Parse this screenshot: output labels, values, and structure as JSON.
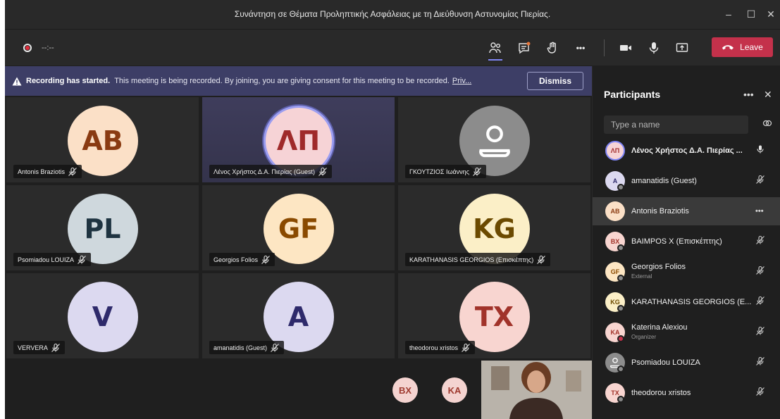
{
  "window": {
    "title": "Συνάντηση σε Θέματα Προληπτικής Ασφάλειας με τη Διεύθυνση Αστυνομίας Πιερίας.",
    "minimize": "–",
    "maximize": "☐",
    "close": "✕"
  },
  "toolbar": {
    "timer": "--:--",
    "leave_label": "Leave",
    "more": "•••"
  },
  "banner": {
    "bold_text": "Recording has started.",
    "text": "This meeting is being recorded. By joining, you are giving consent for this meeting to be recorded.",
    "link": "Priv...",
    "dismiss_label": "Dismiss"
  },
  "tiles": [
    {
      "initials": "AB",
      "name": "Antonis Braziotis",
      "bg": "#fbe0c7",
      "fg": "#8a3b12",
      "photo": false,
      "speaker": false
    },
    {
      "initials": "ΛΠ",
      "name": "Λένος Χρήστος Δ.Α. Πιερίας (Guest)",
      "bg": "#f6d3d6",
      "fg": "#9f2a2a",
      "photo": false,
      "speaker": true
    },
    {
      "initials": "",
      "name": "ΓΚΟΥΤΖΙΟΣ Ιωάννης",
      "bg": "#8c8c8c",
      "fg": "#ffffff",
      "photo": true,
      "speaker": false
    },
    {
      "initials": "PL",
      "name": "Psomiadou LOUIZA",
      "bg": "#cfd8dd",
      "fg": "#1e3340",
      "photo": false,
      "speaker": false
    },
    {
      "initials": "GF",
      "name": "Georgios Folios",
      "bg": "#fde6c3",
      "fg": "#8a4a00",
      "photo": false,
      "speaker": false
    },
    {
      "initials": "KG",
      "name": "KARATHANASIS GEORGIOS (Επισκέπτης)",
      "bg": "#fbefc7",
      "fg": "#6b4a00",
      "photo": false,
      "speaker": false
    },
    {
      "initials": "V",
      "name": "VERVERA",
      "bg": "#dcd9f0",
      "fg": "#2e2a6b",
      "photo": false,
      "speaker": false
    },
    {
      "initials": "A",
      "name": "amanatidis (Guest)",
      "bg": "#dcd9f0",
      "fg": "#2e2a6b",
      "photo": false,
      "speaker": false
    },
    {
      "initials": "TX",
      "name": "theodorou xristos",
      "bg": "#f8d5d0",
      "fg": "#a1332a",
      "photo": false,
      "speaker": false
    }
  ],
  "overflow_avatars": [
    {
      "initials": "BX"
    },
    {
      "initials": "KA"
    }
  ],
  "panel": {
    "title": "Participants",
    "more": "•••",
    "close": "✕",
    "search_placeholder": "Type a name",
    "participants": [
      {
        "initials": "ΛΠ",
        "name": "Λένος Χρήστος Δ.Α. Πιερίας ...",
        "sub": "",
        "bg": "#f6d3d6",
        "fg": "#9f2a2a",
        "icon": "mic",
        "status": "none",
        "speaking": true,
        "selected": false
      },
      {
        "initials": "A",
        "name": "amanatidis (Guest)",
        "sub": "",
        "bg": "#dcd9f0",
        "fg": "#2e2a6b",
        "icon": "mic-off",
        "status": "grey",
        "speaking": false,
        "selected": false
      },
      {
        "initials": "AB",
        "name": "Antonis Braziotis",
        "sub": "",
        "bg": "#fbe0c7",
        "fg": "#8a3b12",
        "icon": "more",
        "status": "none",
        "speaking": false,
        "selected": true
      },
      {
        "initials": "BX",
        "name": "BAIMPOS X (Επισκέπτης)",
        "sub": "",
        "bg": "#f8d5d0",
        "fg": "#a1332a",
        "icon": "mic-off",
        "status": "grey",
        "speaking": false,
        "selected": false
      },
      {
        "initials": "GF",
        "name": "Georgios Folios",
        "sub": "External",
        "bg": "#fde6c3",
        "fg": "#8a4a00",
        "icon": "mic-off",
        "status": "grey",
        "speaking": false,
        "selected": false
      },
      {
        "initials": "KG",
        "name": "KARATHANASIS GEORGIOS (E...",
        "sub": "",
        "bg": "#fbefc7",
        "fg": "#6b4a00",
        "icon": "mic-off",
        "status": "grey",
        "speaking": false,
        "selected": false
      },
      {
        "initials": "KA",
        "name": "Katerina Alexiou",
        "sub": "Organizer",
        "bg": "#f8d5d0",
        "fg": "#a1332a",
        "icon": "mic-off",
        "status": "red",
        "speaking": false,
        "selected": false
      },
      {
        "initials": "",
        "name": "Psomiadou LOUIZA",
        "sub": "",
        "bg": "#8c8c8c",
        "fg": "#ffffff",
        "icon": "mic-off",
        "status": "grey",
        "speaking": false,
        "selected": false
      },
      {
        "initials": "TX",
        "name": "theodorou xristos",
        "sub": "",
        "bg": "#f8d5d0",
        "fg": "#a1332a",
        "icon": "mic-off",
        "status": "grey",
        "speaking": false,
        "selected": false
      }
    ]
  }
}
